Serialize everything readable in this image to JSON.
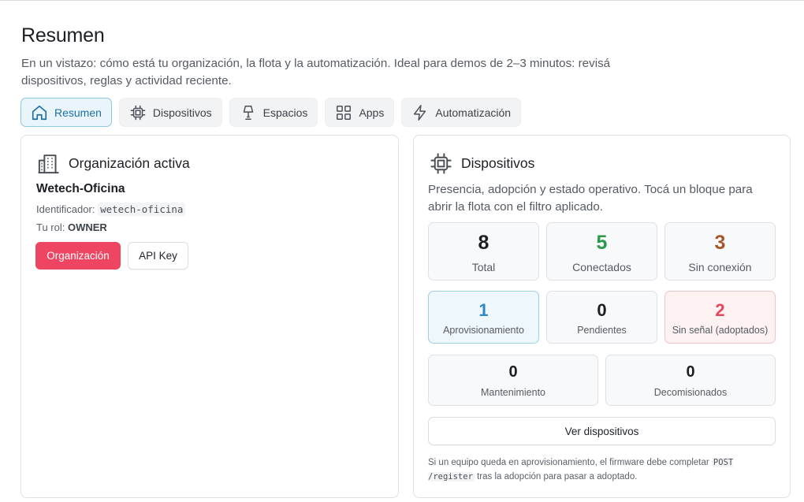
{
  "page": {
    "title": "Resumen",
    "subtitle": "En un vistazo: cómo está tu organización, la flota y la automatización. Ideal para demos de 2–3 minutos: revisá dispositivos, reglas y actividad reciente."
  },
  "tabs": [
    {
      "label": "Resumen",
      "icon": "home-icon",
      "active": true
    },
    {
      "label": "Dispositivos",
      "icon": "chip-icon"
    },
    {
      "label": "Espacios",
      "icon": "lamp-icon"
    },
    {
      "label": "Apps",
      "icon": "grid-icon"
    },
    {
      "label": "Automatización",
      "icon": "bolt-icon"
    }
  ],
  "org": {
    "heading": "Organización activa",
    "name": "Wetech-Oficina",
    "id_label": "Identificador:",
    "id_value": "wetech-oficina",
    "role_label": "Tu rol:",
    "role_value": "OWNER",
    "primary_button": "Organización",
    "secondary_button": "API Key"
  },
  "devices": {
    "heading": "Dispositivos",
    "description": "Presencia, adopción y estado operativo. Tocá un bloque para abrir la flota con el filtro aplicado.",
    "stats": {
      "total": {
        "value": "8",
        "label": "Total"
      },
      "connected": {
        "value": "5",
        "label": "Conectados"
      },
      "offline": {
        "value": "3",
        "label": "Sin conexión"
      },
      "provisioning": {
        "value": "1",
        "label": "Aprovisionamiento"
      },
      "pending": {
        "value": "0",
        "label": "Pendientes"
      },
      "no_signal": {
        "value": "2",
        "label": "Sin señal (adoptados)"
      },
      "maintenance": {
        "value": "0",
        "label": "Mantenimiento"
      },
      "decommissioned": {
        "value": "0",
        "label": "Decomisionados"
      }
    },
    "view_button": "Ver dispositivos",
    "note_prefix": "Si un equipo queda en aprovisionamiento, el firmware debe completar",
    "note_code": "POST /register",
    "note_suffix": "tras la adopción para pasar a adoptado."
  },
  "colors": {
    "accent": "#1d6fa5",
    "primary_button": "#ee4662",
    "connected": "#2a9a4a",
    "offline": "#a4582a",
    "provisioning": "#2f8ac4",
    "no_signal": "#e5485c"
  }
}
